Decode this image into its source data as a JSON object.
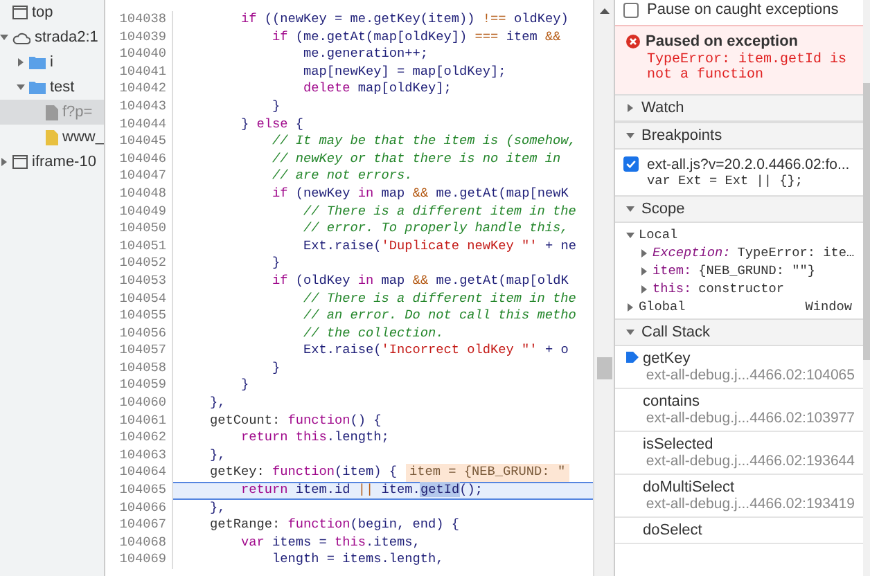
{
  "navigator": {
    "tree": [
      {
        "label": "top",
        "kind": "frame",
        "selected": false
      },
      {
        "label": "strada2:1",
        "kind": "host",
        "expanded": true,
        "selected": false,
        "children": [
          {
            "label": "i",
            "kind": "folder",
            "expanded": false,
            "selected": false
          },
          {
            "label": "test",
            "kind": "folder",
            "expanded": true,
            "selected": false,
            "children": [
              {
                "label": "f?p=",
                "kind": "file",
                "selected": true
              },
              {
                "label": "www_",
                "kind": "script",
                "selected": false
              }
            ]
          }
        ]
      },
      {
        "label": "iframe-10",
        "kind": "frame",
        "expanded": false,
        "selected": false
      }
    ]
  },
  "editor": {
    "lines": [
      {
        "number": "104038",
        "paused": false,
        "tokens": [
          {
            "kind": "keyword",
            "text": "        if "
          },
          {
            "kind": "plain",
            "text": "((newKey = me.getKey(item)) "
          },
          {
            "kind": "operator",
            "text": "!=="
          },
          {
            "kind": "plain",
            "text": " oldKey)"
          }
        ]
      },
      {
        "number": "104039",
        "paused": false,
        "tokens": [
          {
            "kind": "keyword",
            "text": "            if "
          },
          {
            "kind": "plain",
            "text": "(me.getAt(map[oldKey]) "
          },
          {
            "kind": "operator",
            "text": "==="
          },
          {
            "kind": "plain",
            "text": " item "
          },
          {
            "kind": "operator",
            "text": "&&"
          }
        ]
      },
      {
        "number": "104040",
        "paused": false,
        "tokens": [
          {
            "kind": "plain",
            "text": "                me.generation++;"
          }
        ]
      },
      {
        "number": "104041",
        "paused": false,
        "tokens": [
          {
            "kind": "plain",
            "text": "                map[newKey] = map[oldKey];"
          }
        ]
      },
      {
        "number": "104042",
        "paused": false,
        "tokens": [
          {
            "kind": "keyword",
            "text": "                delete "
          },
          {
            "kind": "plain",
            "text": "map[oldKey];"
          }
        ]
      },
      {
        "number": "104043",
        "paused": false,
        "tokens": [
          {
            "kind": "plain",
            "text": "            }"
          }
        ]
      },
      {
        "number": "104044",
        "paused": false,
        "tokens": [
          {
            "kind": "plain",
            "text": "        } "
          },
          {
            "kind": "keyword",
            "text": "else"
          },
          {
            "kind": "plain",
            "text": " {"
          }
        ]
      },
      {
        "number": "104045",
        "paused": false,
        "tokens": [
          {
            "kind": "comment",
            "text": "            // It may be that the item is (somehow,"
          }
        ]
      },
      {
        "number": "104046",
        "paused": false,
        "tokens": [
          {
            "kind": "comment",
            "text": "            // newKey or that there is no item in"
          }
        ]
      },
      {
        "number": "104047",
        "paused": false,
        "tokens": [
          {
            "kind": "comment",
            "text": "            // are not errors."
          }
        ]
      },
      {
        "number": "104048",
        "paused": false,
        "tokens": [
          {
            "kind": "keyword",
            "text": "            if "
          },
          {
            "kind": "plain",
            "text": "(newKey "
          },
          {
            "kind": "keyword",
            "text": "in"
          },
          {
            "kind": "plain",
            "text": " map "
          },
          {
            "kind": "operator",
            "text": "&&"
          },
          {
            "kind": "plain",
            "text": " me.getAt(map[newK"
          }
        ]
      },
      {
        "number": "104049",
        "paused": false,
        "tokens": [
          {
            "kind": "comment",
            "text": "                // There is a different item in the"
          }
        ]
      },
      {
        "number": "104050",
        "paused": false,
        "tokens": [
          {
            "kind": "comment",
            "text": "                // error. To properly handle this,"
          }
        ]
      },
      {
        "number": "104051",
        "paused": false,
        "tokens": [
          {
            "kind": "plain",
            "text": "                Ext.raise("
          },
          {
            "kind": "string",
            "text": "'Duplicate newKey \"'"
          },
          {
            "kind": "plain",
            "text": " + ne"
          }
        ]
      },
      {
        "number": "104052",
        "paused": false,
        "tokens": [
          {
            "kind": "plain",
            "text": "            }"
          }
        ]
      },
      {
        "number": "104053",
        "paused": false,
        "tokens": [
          {
            "kind": "keyword",
            "text": "            if "
          },
          {
            "kind": "plain",
            "text": "(oldKey "
          },
          {
            "kind": "keyword",
            "text": "in"
          },
          {
            "kind": "plain",
            "text": " map "
          },
          {
            "kind": "operator",
            "text": "&&"
          },
          {
            "kind": "plain",
            "text": " me.getAt(map[oldK"
          }
        ]
      },
      {
        "number": "104054",
        "paused": false,
        "tokens": [
          {
            "kind": "comment",
            "text": "                // There is a different item in the"
          }
        ]
      },
      {
        "number": "104055",
        "paused": false,
        "tokens": [
          {
            "kind": "comment",
            "text": "                // an error. Do not call this metho"
          }
        ]
      },
      {
        "number": "104056",
        "paused": false,
        "tokens": [
          {
            "kind": "comment",
            "text": "                // the collection."
          }
        ]
      },
      {
        "number": "104057",
        "paused": false,
        "tokens": [
          {
            "kind": "plain",
            "text": "                Ext.raise("
          },
          {
            "kind": "string",
            "text": "'Incorrect oldKey \"'"
          },
          {
            "kind": "plain",
            "text": " + o"
          }
        ]
      },
      {
        "number": "104058",
        "paused": false,
        "tokens": [
          {
            "kind": "plain",
            "text": "            }"
          }
        ]
      },
      {
        "number": "104059",
        "paused": false,
        "tokens": [
          {
            "kind": "plain",
            "text": "        }"
          }
        ]
      },
      {
        "number": "104060",
        "paused": false,
        "tokens": [
          {
            "kind": "plain",
            "text": "    },"
          }
        ]
      },
      {
        "number": "104061",
        "paused": false,
        "tokens": [
          {
            "kind": "property",
            "text": "    getCount: "
          },
          {
            "kind": "keyword",
            "text": "function"
          },
          {
            "kind": "plain",
            "text": "() {"
          }
        ]
      },
      {
        "number": "104062",
        "paused": false,
        "tokens": [
          {
            "kind": "keyword",
            "text": "        return "
          },
          {
            "kind": "keyword",
            "text": "this"
          },
          {
            "kind": "plain",
            "text": ".length;"
          }
        ]
      },
      {
        "number": "104063",
        "paused": false,
        "tokens": [
          {
            "kind": "plain",
            "text": "    },"
          }
        ]
      },
      {
        "number": "104064",
        "paused": false,
        "inline_value": "item = {NEB_GRUND: \"",
        "tokens": [
          {
            "kind": "property",
            "text": "    getKey: "
          },
          {
            "kind": "keyword",
            "text": "function"
          },
          {
            "kind": "plain",
            "text": "(item) {"
          }
        ]
      },
      {
        "number": "104065",
        "paused": true,
        "tokens": [
          {
            "kind": "keyword",
            "text": "        return "
          },
          {
            "kind": "plain",
            "text": "item.id "
          },
          {
            "kind": "operator",
            "text": "||"
          },
          {
            "kind": "plain",
            "text": " item."
          },
          {
            "kind": "selection",
            "text": "getId"
          },
          {
            "kind": "plain",
            "text": "();"
          }
        ]
      },
      {
        "number": "104066",
        "paused": false,
        "tokens": [
          {
            "kind": "plain",
            "text": "    },"
          }
        ]
      },
      {
        "number": "104067",
        "paused": false,
        "tokens": [
          {
            "kind": "property",
            "text": "    getRange: "
          },
          {
            "kind": "keyword",
            "text": "function"
          },
          {
            "kind": "plain",
            "text": "(begin, end) {"
          }
        ]
      },
      {
        "number": "104068",
        "paused": false,
        "tokens": [
          {
            "kind": "keyword",
            "text": "        var "
          },
          {
            "kind": "plain",
            "text": "items = "
          },
          {
            "kind": "keyword",
            "text": "this"
          },
          {
            "kind": "plain",
            "text": ".items,"
          }
        ]
      },
      {
        "number": "104069",
        "paused": false,
        "tokens": [
          {
            "kind": "plain",
            "text": "            length = items.length,"
          }
        ]
      }
    ]
  },
  "debugger": {
    "pause_caught": {
      "label": "Pause on caught exceptions",
      "checked": false
    },
    "paused_banner": {
      "title": "Paused on exception",
      "message": "TypeError: item.getId is not a function"
    },
    "sections": [
      {
        "kind": "watch",
        "title": "Watch",
        "expanded": false
      },
      {
        "kind": "breakpoints",
        "title": "Breakpoints",
        "expanded": true,
        "breakpoints": [
          {
            "file": "ext-all.js?v=20.2.0.4466.02:fo...",
            "code": "var Ext = Ext || {};",
            "checked": true
          }
        ]
      },
      {
        "kind": "scope",
        "title": "Scope",
        "expanded": true,
        "groups": [
          {
            "name": "Local",
            "expanded": true,
            "entries": [
              {
                "name": "Exception:",
                "value": "TypeError: ite…",
                "kind": "exception",
                "expanded": false
              },
              {
                "name": "item:",
                "value": "{NEB_GRUND: \"\"}",
                "kind": "variable",
                "expanded": false
              },
              {
                "name": "this:",
                "value": "constructor",
                "kind": "variable",
                "expanded": false
              }
            ]
          },
          {
            "name": "Global",
            "value": "Window",
            "expanded": false
          }
        ]
      },
      {
        "kind": "callstack",
        "title": "Call Stack",
        "expanded": true,
        "frames": [
          {
            "name": "getKey",
            "location": "ext-all-debug.j...4466.02:104065",
            "selected": true
          },
          {
            "name": "contains",
            "location": "ext-all-debug.j...4466.02:103977",
            "selected": false
          },
          {
            "name": "isSelected",
            "location": "ext-all-debug.j...4466.02:193644",
            "selected": false
          },
          {
            "name": "doMultiSelect",
            "location": "ext-all-debug.j...4466.02:193419",
            "selected": false
          },
          {
            "name": "doSelect",
            "selected": false
          }
        ]
      }
    ]
  }
}
